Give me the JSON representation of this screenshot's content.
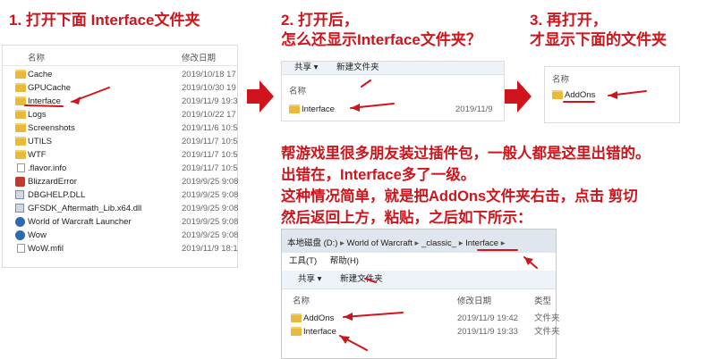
{
  "steps": {
    "step1": "1. 打开下面 Interface文件夹",
    "step2_line1": "2. 打开后，",
    "step2_line2": "怎么还显示Interface文件夹？",
    "step3_line1": "3. 再打开，",
    "step3_line2": "才显示下面的文件夹"
  },
  "panel1": {
    "col_name": "名称",
    "col_date": "修改日期",
    "rows": [
      {
        "name": "Cache",
        "date": "2019/10/18 17",
        "icon": "folder-icon"
      },
      {
        "name": "GPUCache",
        "date": "2019/10/30 19",
        "icon": "folder-icon"
      },
      {
        "name": "Interface",
        "date": "2019/11/9 19:3",
        "icon": "folder-icon"
      },
      {
        "name": "Logs",
        "date": "2019/10/22 17",
        "icon": "folder-icon"
      },
      {
        "name": "Screenshots",
        "date": "2019/11/6 10:5",
        "icon": "folder-icon"
      },
      {
        "name": "UTILS",
        "date": "2019/11/7 10:5",
        "icon": "folder-icon"
      },
      {
        "name": "WTF",
        "date": "2019/11/7 10:5",
        "icon": "folder-icon"
      },
      {
        "name": ".flavor.info",
        "date": "2019/11/7 10:5",
        "icon": "file-icon"
      },
      {
        "name": "BlizzardError",
        "date": "2019/9/25 9:08",
        "icon": "blizzard-error-icon"
      },
      {
        "name": "DBGHELP.DLL",
        "date": "2019/9/25 9:08",
        "icon": "dll-icon"
      },
      {
        "name": "GFSDK_Aftermath_Lib.x64.dll",
        "date": "2019/9/25 9:08",
        "icon": "dll-icon"
      },
      {
        "name": "World of Warcraft Launcher",
        "date": "2019/9/25 9:08",
        "icon": "launcher-icon"
      },
      {
        "name": "Wow",
        "date": "2019/9/25 9:08",
        "icon": "wow-icon"
      },
      {
        "name": "WoW.mfil",
        "date": "2019/11/9 18:1",
        "icon": "file-icon"
      }
    ]
  },
  "panel2": {
    "toolbar_share": "共享 ▾",
    "toolbar_new_folder": "新建文件夹",
    "col_name": "名称",
    "row_name": "Interface",
    "row_date": "2019/11/9"
  },
  "panel3": {
    "col_name": "名称",
    "row_name": "AddOns"
  },
  "explanation": {
    "line1": "帮游戏里很多朋友装过插件包，一般人都是这里出错的。",
    "line2": "出错在，Interface多了一级。",
    "line3": "这种情况简单，就是把AddOns文件夹右击，点击 剪切",
    "line4": "然后返回上方，粘贴，之后如下所示："
  },
  "panel4": {
    "crumbs": [
      "本地磁盘 (D:)",
      "World of Warcraft",
      "_classic_",
      "Interface"
    ],
    "menu_tools": "工具(T)",
    "menu_help": "帮助(H)",
    "toolbar_share": "共享 ▾",
    "toolbar_new_folder": "新建文件夹",
    "col_name": "名称",
    "col_date": "修改日期",
    "col_type": "类型",
    "rows": [
      {
        "name": "AddOns",
        "date": "2019/11/9 19:42",
        "type": "文件夹"
      },
      {
        "name": "Interface",
        "date": "2019/11/9 19:33",
        "type": "文件夹"
      }
    ]
  },
  "colors": {
    "annotation_red": "#d0141b",
    "folder_yellow": "#e8b93a"
  }
}
